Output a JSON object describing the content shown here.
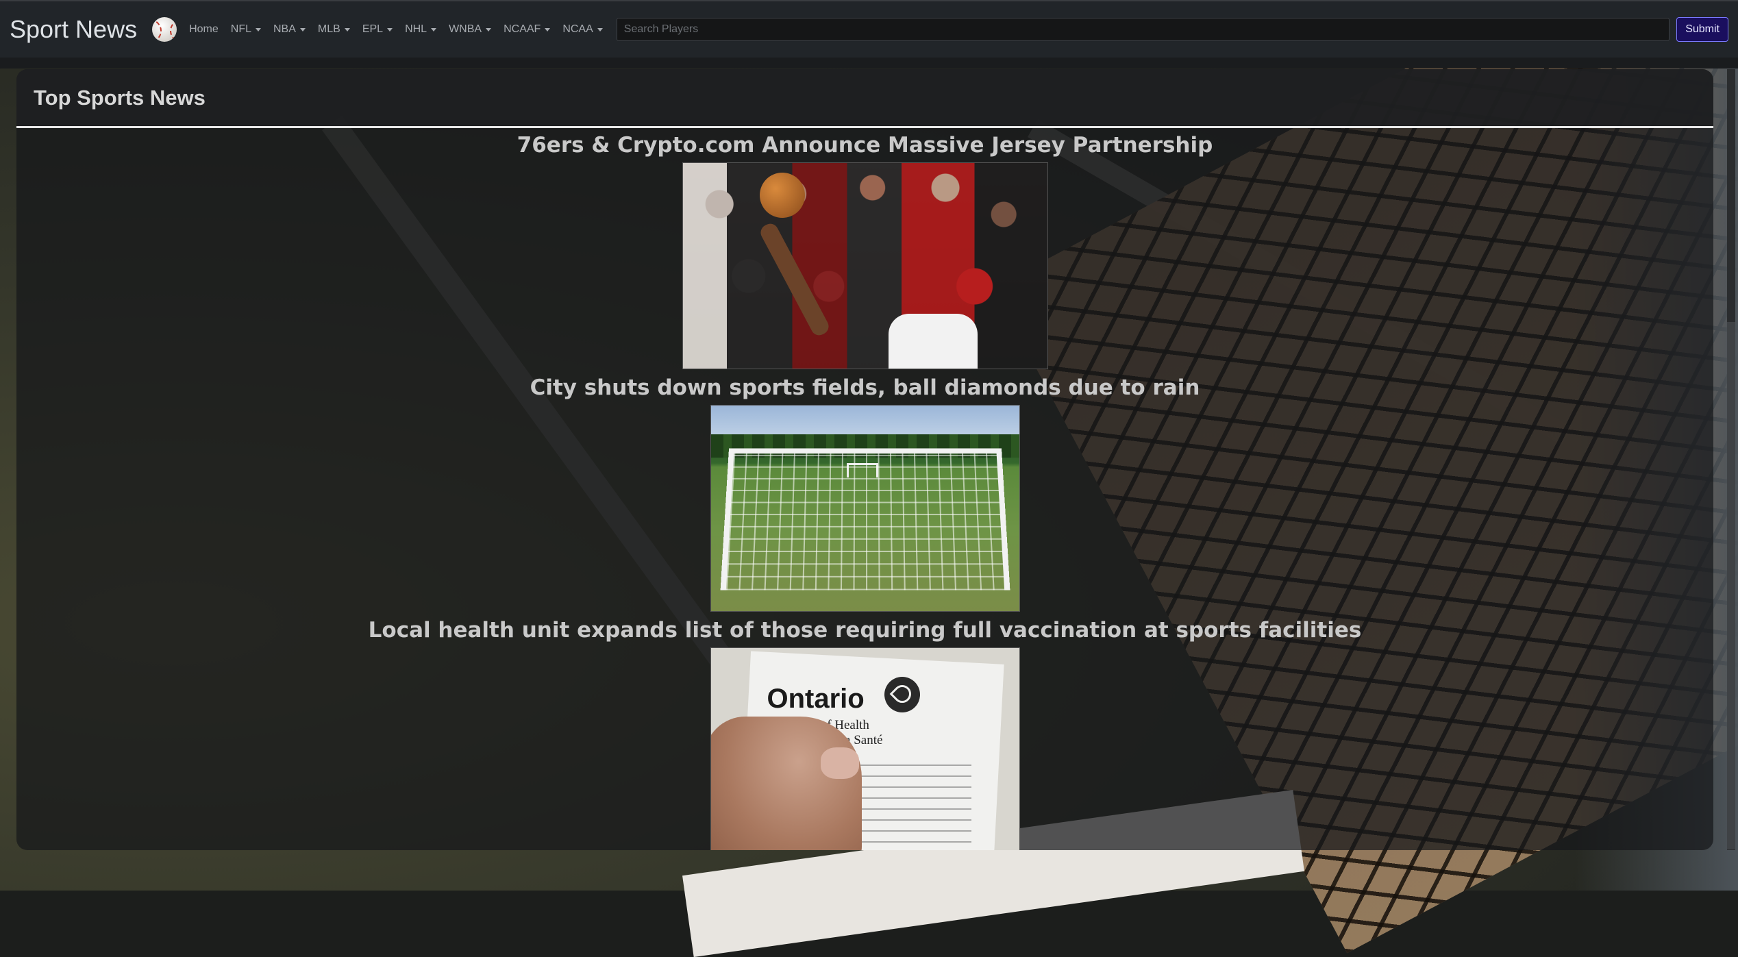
{
  "navbar": {
    "brand": "Sport News",
    "brand_icon": "baseball-icon",
    "items": [
      {
        "label": "Home",
        "dropdown": false
      },
      {
        "label": "NFL",
        "dropdown": true
      },
      {
        "label": "NBA",
        "dropdown": true
      },
      {
        "label": "MLB",
        "dropdown": true
      },
      {
        "label": "EPL",
        "dropdown": true
      },
      {
        "label": "NHL",
        "dropdown": true
      },
      {
        "label": "WNBA",
        "dropdown": true
      },
      {
        "label": "NCAAF",
        "dropdown": true
      },
      {
        "label": "NCAA",
        "dropdown": true
      }
    ],
    "search_placeholder": "Search Players",
    "submit_label": "Submit",
    "submit_color": "#1a0f5e"
  },
  "main": {
    "title": "Top Sports News",
    "articles": [
      {
        "headline": "76ers & Crypto.com Announce Massive Jersey Partnership",
        "image": "basketball-game-photo"
      },
      {
        "headline": "City shuts down sports fields, ball diamonds due to rain",
        "image": "soccer-goal-photo"
      },
      {
        "headline": "Local health unit expands list of those requiring full vaccination at sports facilities",
        "image": "vaccination-receipt-photo"
      }
    ],
    "receipt_text": {
      "province": "Ontario",
      "ministry_en": "Ministry of Health",
      "ministry_fr": "Ministère de la Santé"
    }
  }
}
